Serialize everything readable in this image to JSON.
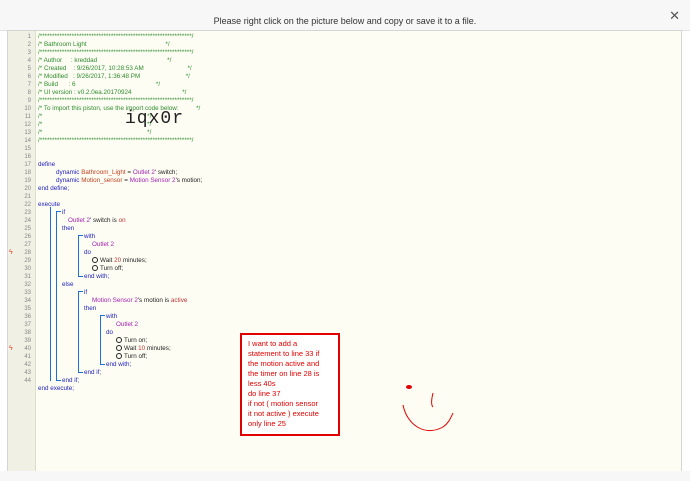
{
  "window": {
    "instruction": "Please right click on the picture below and copy or save it to a file."
  },
  "gutter": {
    "line_numbers": [
      "1",
      "2",
      "3",
      "4",
      "5",
      "6",
      "7",
      "8",
      "9",
      "10",
      "11",
      "12",
      "13",
      "14",
      "15",
      "16",
      "17",
      "18",
      "19",
      "20",
      "21",
      "22",
      "23",
      "24",
      "25",
      "26",
      "27",
      "28",
      "29",
      "30",
      "31",
      "32",
      "33",
      "34",
      "35",
      "36",
      "37",
      "38",
      "39",
      "40",
      "41",
      "42",
      "43",
      "44"
    ]
  },
  "header_comments": {
    "stars": "/**************************************************************/",
    "title": "/* Bathroom Light                                             */",
    "author": "/* Author     : kreddad                                        */",
    "created": "/* Created    : 9/26/2017, 10:28:53 AM                         */",
    "modified": "/* Modified   : 9/26/2017, 1:36:48 PM                          */",
    "build": "/* Build      : 6                                              */",
    "ui_version": "/* UI version : v0.2.0ea.20170924                             */",
    "import_hint": "/* To import this piston, use the import code below:          */",
    "blank": "/*                                                            */",
    "import_code": "iqx0r"
  },
  "code": {
    "define": "define",
    "dynamic": "dynamic",
    "var_bathroom": "Bathroom_Light",
    "eq": " = ",
    "dev_outlet2": "Outlet 2",
    "switch_suffix": "' switch;",
    "var_motion": "Motion_sensor",
    "dev_motion": "Motion Sensor 2",
    "motion_suffix": "'s motion;",
    "end_define": "end define;",
    "execute": "execute",
    "if": "if",
    "switch_is": "' switch is ",
    "on": "on",
    "then": "then",
    "with": "with",
    "do": "do",
    "wait": "Wait ",
    "wait20": "20",
    "minutes": " minutes;",
    "turn_off": "Turn off;",
    "end_with": "end with;",
    "else": "else",
    "motion_is": "'s motion is ",
    "active": "active",
    "turn_on": "Turn on;",
    "wait10": "10",
    "end_if": "end if;",
    "end_execute": "end execute;"
  },
  "annotation": {
    "text": "I want to add a\nstatement to line 33 if\nthe motion active and\nthe timer on line 28 is\nless 40s\ndo line 37\nif not ( motion sensor\nit not active ) execute\nonly line 25",
    "color": "#e00000"
  }
}
